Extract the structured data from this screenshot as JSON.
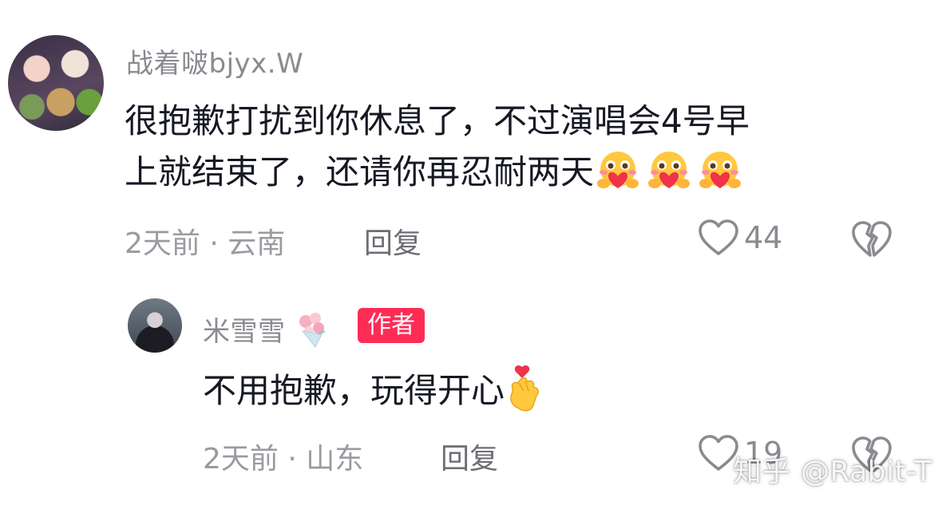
{
  "comments": [
    {
      "username": "战着啵bjyx.W",
      "text_line1": "很抱歉打扰到你休息了，不过演唱会4号早",
      "text_line2": "上就结束了，还请你再忍耐两天",
      "time_location": "2天前 · 云南",
      "reply_label": "回复",
      "likes": "44",
      "emoji": "heart-hug-face-icon"
    },
    {
      "username": "米雪雪",
      "author_tag": "作者",
      "text": "不用抱歉，玩得开心",
      "time_location": "2天前 · 山东",
      "reply_label": "回复",
      "likes": "19",
      "emoji": "finger-heart-icon"
    }
  ],
  "watermark": "知乎 @Rabit-T",
  "colors": {
    "accent": "#fe2c55",
    "text": "#161823",
    "muted": "#8a8b91"
  }
}
